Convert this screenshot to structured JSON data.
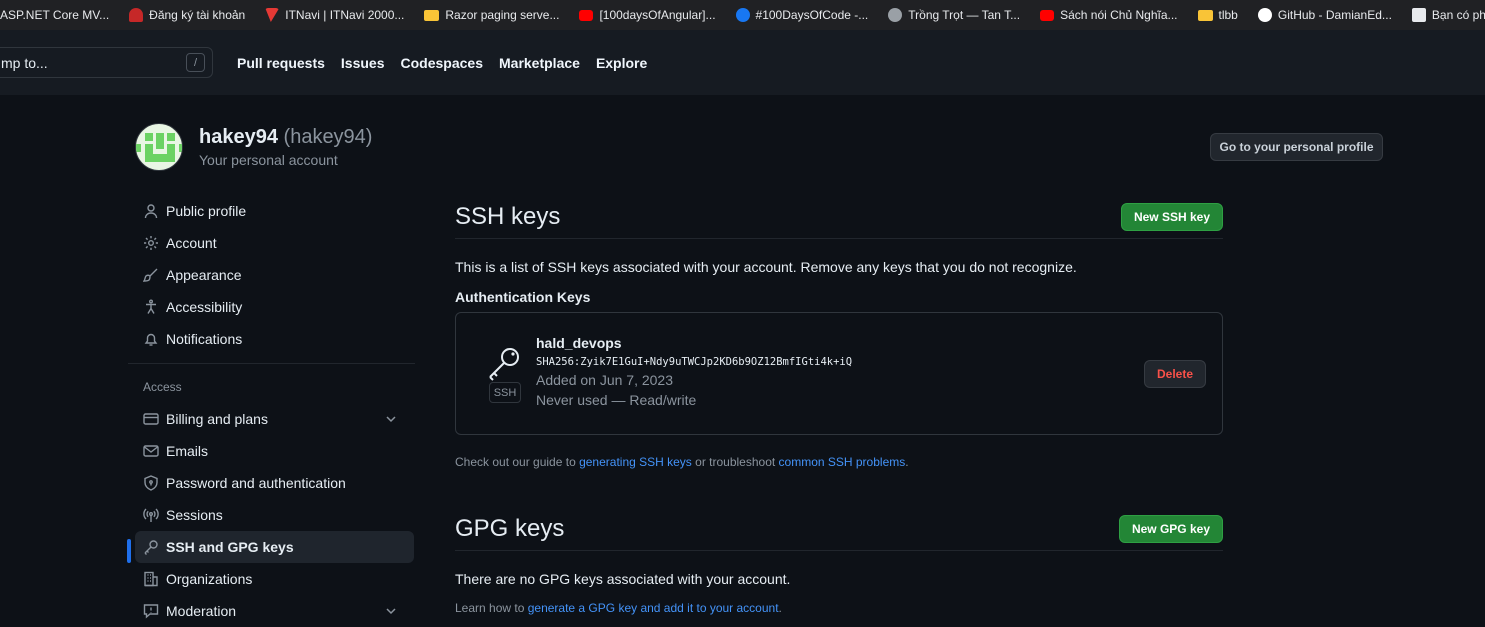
{
  "bookmarks": [
    {
      "label": "ASP.NET Core MV...",
      "icon": "asp-net-icon",
      "color": "#5c2d91"
    },
    {
      "label": "Đăng ký tài khoản",
      "icon": "site-icon",
      "color": "#c62828"
    },
    {
      "label": "ITNavi | ITNavi 2000...",
      "icon": "itnavi-icon",
      "color": "#e53935"
    },
    {
      "label": "Razor paging serve...",
      "icon": "folder-icon",
      "color": "#f9c437"
    },
    {
      "label": "[100daysOfAngular]...",
      "icon": "youtube-icon",
      "color": "#ff0000"
    },
    {
      "label": "#100DaysOfCode -...",
      "icon": "facebook-icon",
      "color": "#1877f2"
    },
    {
      "label": "Trồng Trọt — Tan T...",
      "icon": "globe-icon",
      "color": "#9aa0a6"
    },
    {
      "label": "Sách nói Chủ Nghĩa...",
      "icon": "youtube-icon",
      "color": "#ff0000"
    },
    {
      "label": "tlbb",
      "icon": "folder-icon",
      "color": "#f9c437"
    },
    {
      "label": "GitHub - DamianEd...",
      "icon": "github-icon",
      "color": "#ffffff"
    },
    {
      "label": "Bạn có phải là r",
      "icon": "site-icon",
      "color": "#e8eaed"
    }
  ],
  "header": {
    "search_placeholder": "mp to...",
    "search_shortcut": "/",
    "nav": [
      "Pull requests",
      "Issues",
      "Codespaces",
      "Marketplace",
      "Explore"
    ]
  },
  "profile": {
    "username": "hakey94",
    "handle": "(hakey94)",
    "subtitle": "Your personal account",
    "go_profile_label": "Go to your personal profile"
  },
  "sidebar": {
    "items_top": [
      {
        "label": "Public profile",
        "icon": "person-icon"
      },
      {
        "label": "Account",
        "icon": "gear-icon"
      },
      {
        "label": "Appearance",
        "icon": "paintbrush-icon"
      },
      {
        "label": "Accessibility",
        "icon": "accessibility-icon"
      },
      {
        "label": "Notifications",
        "icon": "bell-icon"
      }
    ],
    "group_access": "Access",
    "items_access": [
      {
        "label": "Billing and plans",
        "icon": "credit-card-icon",
        "chevron": true
      },
      {
        "label": "Emails",
        "icon": "mail-icon"
      },
      {
        "label": "Password and authentication",
        "icon": "shield-lock-icon"
      },
      {
        "label": "Sessions",
        "icon": "broadcast-icon"
      },
      {
        "label": "SSH and GPG keys",
        "icon": "key-icon",
        "active": true
      },
      {
        "label": "Organizations",
        "icon": "organization-icon"
      },
      {
        "label": "Moderation",
        "icon": "report-icon",
        "chevron": true
      }
    ]
  },
  "ssh": {
    "title": "SSH keys",
    "new_label": "New SSH key",
    "description": "This is a list of SSH keys associated with your account. Remove any keys that you do not recognize.",
    "auth_heading": "Authentication Keys",
    "key": {
      "name": "hald_devops",
      "badge": "SSH",
      "fingerprint": "SHA256:Zyik7E1GuI+Ndy9uTWCJp2KD6b9OZ12BmfIGti4k+iQ",
      "added": "Added on Jun 7, 2023",
      "usage": "Never used — Read/write",
      "delete_label": "Delete"
    },
    "footnote_pre": "Check out our guide to ",
    "footnote_link1": "generating SSH keys",
    "footnote_mid": " or troubleshoot ",
    "footnote_link2": "common SSH problems",
    "footnote_post": "."
  },
  "gpg": {
    "title": "GPG keys",
    "new_label": "New GPG key",
    "description": "There are no GPG keys associated with your account.",
    "footnote_pre": "Learn how to ",
    "footnote_link": "generate a GPG key and add it to your account",
    "footnote_post": "."
  },
  "colors": {
    "bg": "#0d1117",
    "header_bg": "#161b22",
    "green_button": "#238636",
    "link": "#4493f8",
    "danger": "#f85149",
    "active_indicator": "#1f6feb"
  }
}
